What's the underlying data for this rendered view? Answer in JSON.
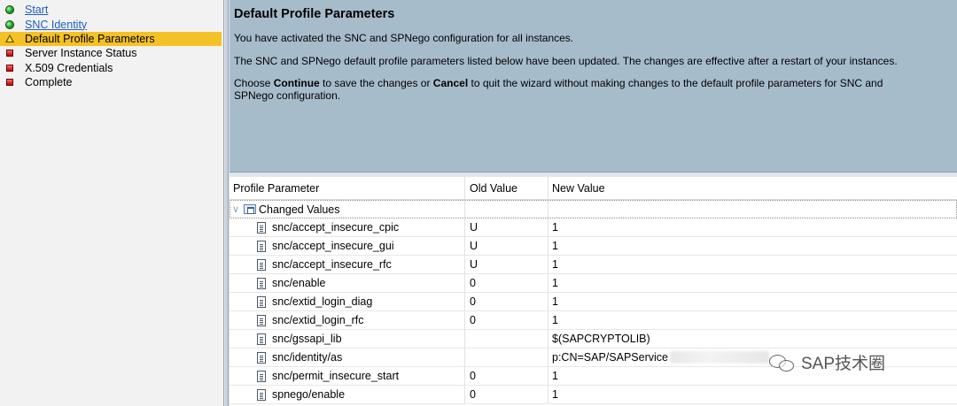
{
  "sidebar": {
    "steps": [
      {
        "label": "Start",
        "status": "green",
        "link": true
      },
      {
        "label": "SNC Identity",
        "status": "green",
        "link": true
      },
      {
        "label": "Default Profile Parameters",
        "status": "yellow",
        "link": false,
        "active": true
      },
      {
        "label": "Server Instance Status",
        "status": "red",
        "link": false
      },
      {
        "label": "X.509 Credentials",
        "status": "red",
        "link": false
      },
      {
        "label": "Complete",
        "status": "red",
        "link": false
      }
    ]
  },
  "info": {
    "title": "Default Profile Parameters",
    "line1": "You have activated the SNC and SPNego configuration for all instances.",
    "line2": "The SNC and SPNego default profile parameters listed below have been updated. The changes are effective after a restart of your instances.",
    "line3_pre": "Choose ",
    "line3_continue": "Continue",
    "line3_mid": " to save the changes or ",
    "line3_cancel": "Cancel",
    "line3_post": " to quit the wizard without making changes to the default profile parameters for SNC and SPNego configuration."
  },
  "table": {
    "headers": {
      "param": "Profile Parameter",
      "old": "Old Value",
      "new": "New Value"
    },
    "group_label": "Changed Values",
    "rows": [
      {
        "param": "snc/accept_insecure_cpic",
        "old": "U",
        "new": "1"
      },
      {
        "param": "snc/accept_insecure_gui",
        "old": "U",
        "new": "1"
      },
      {
        "param": "snc/accept_insecure_rfc",
        "old": "U",
        "new": "1"
      },
      {
        "param": "snc/enable",
        "old": "0",
        "new": "1"
      },
      {
        "param": "snc/extid_login_diag",
        "old": "0",
        "new": "1"
      },
      {
        "param": "snc/extid_login_rfc",
        "old": "0",
        "new": "1"
      },
      {
        "param": "snc/gssapi_lib",
        "old": "",
        "new": "$(SAPCRYPTOLIB)"
      },
      {
        "param": "snc/identity/as",
        "old": "",
        "new": "p:CN=SAP/SAPService"
      },
      {
        "param": "snc/permit_insecure_start",
        "old": "0",
        "new": "1"
      },
      {
        "param": "spnego/enable",
        "old": "0",
        "new": "1"
      }
    ]
  },
  "watermark": {
    "text": "SAP技术圈"
  },
  "colors": {
    "active_step": "#f4c126",
    "header_bg": "#a7bccb",
    "link": "#1f5fc5"
  }
}
